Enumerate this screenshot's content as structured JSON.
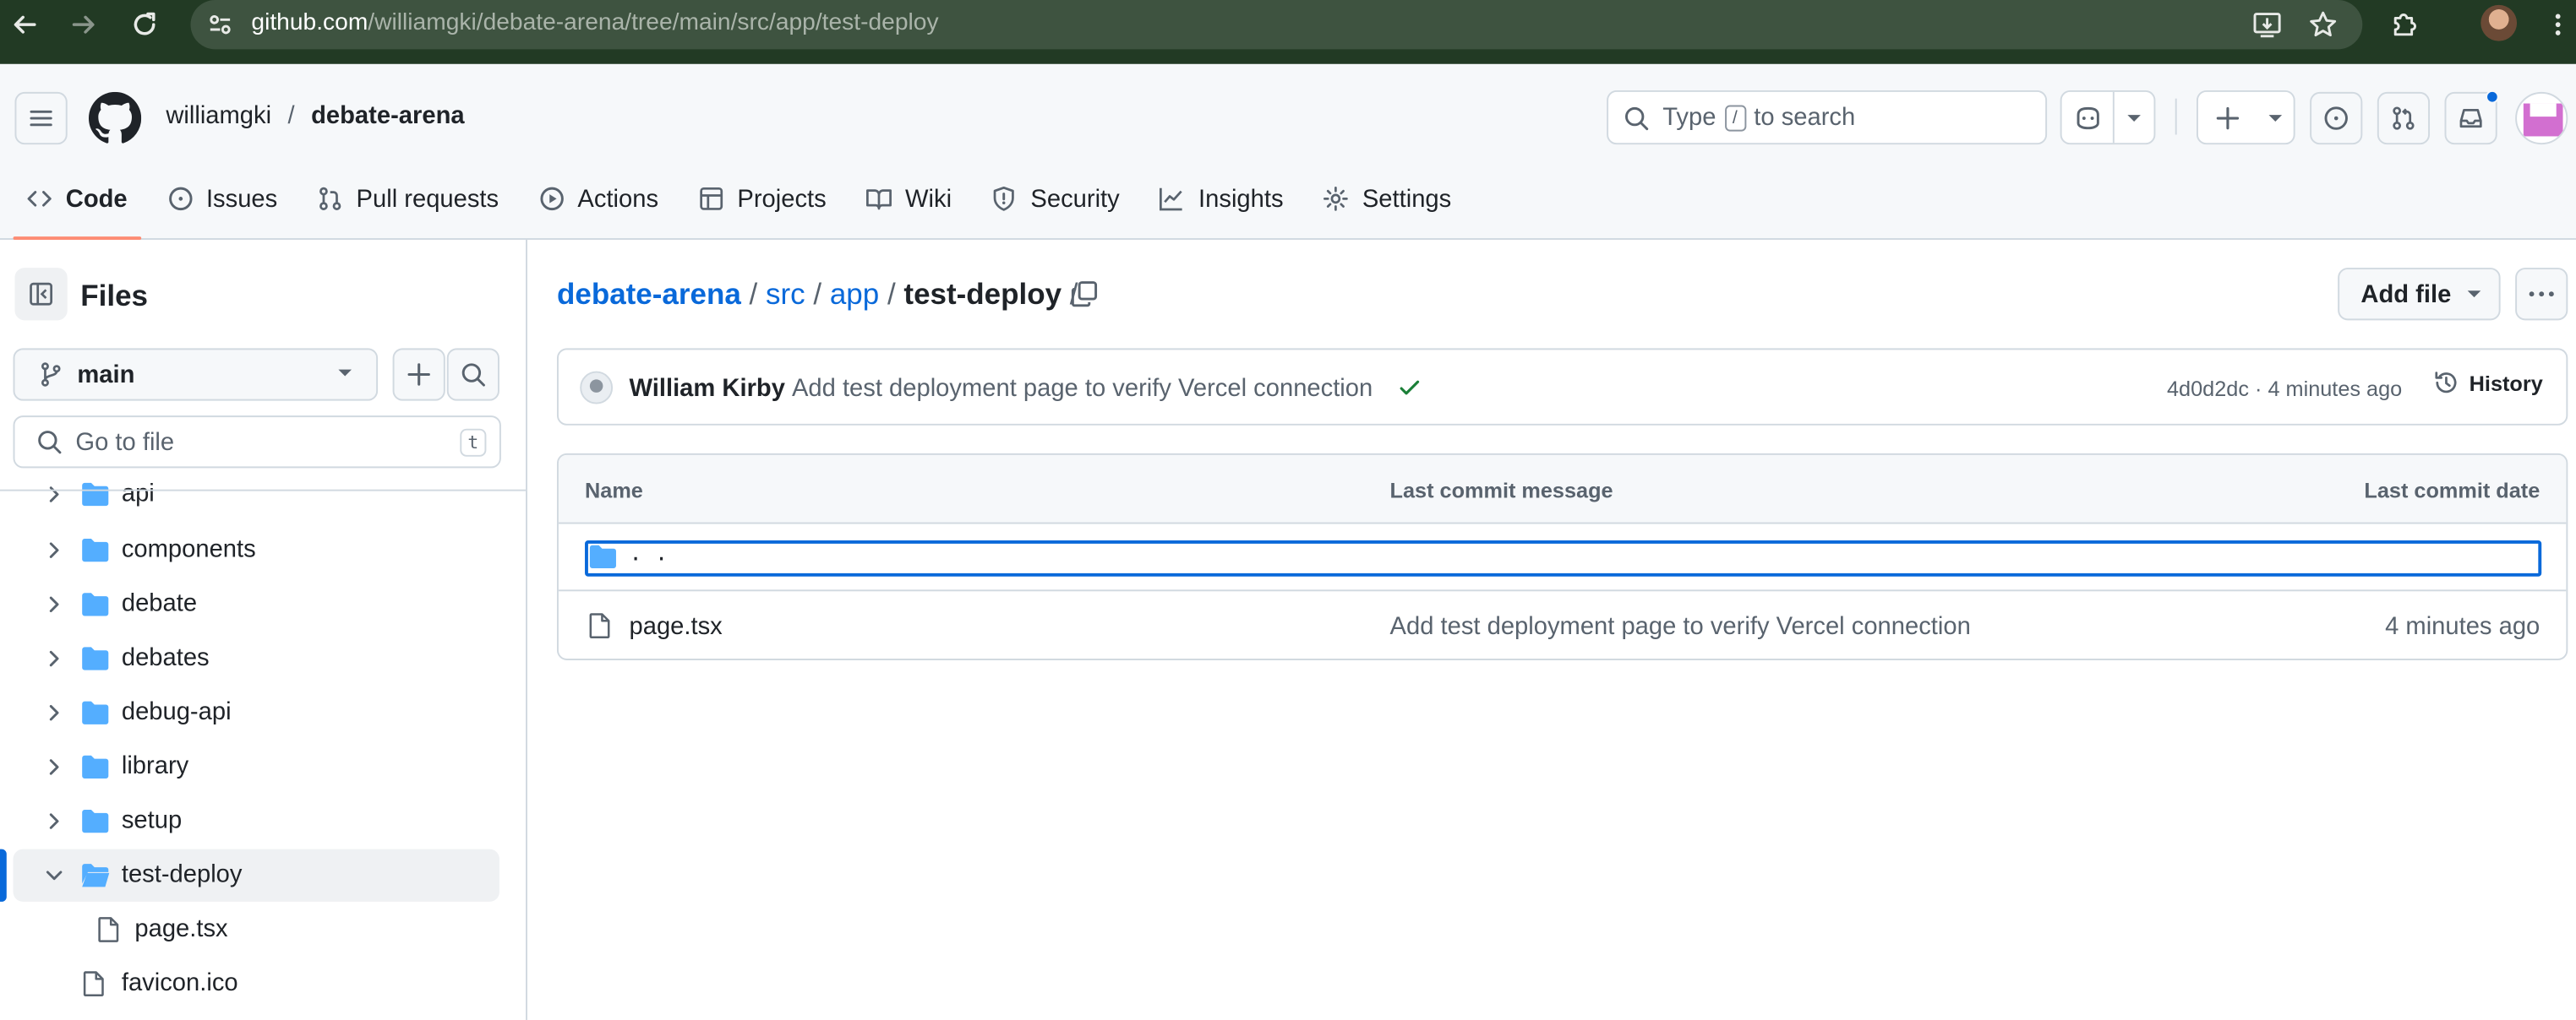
{
  "browser": {
    "url_host": "github.com",
    "url_path": "/williamgki/debate-arena/tree/main/src/app/test-deploy"
  },
  "header": {
    "owner": "williamgki",
    "separator": "/",
    "repo": "debate-arena",
    "search": {
      "prefix": "Type",
      "key": "/",
      "suffix": "to search"
    }
  },
  "tabs": [
    {
      "label": "Code",
      "icon": "code-icon",
      "selected": true
    },
    {
      "label": "Issues",
      "icon": "issue-opened-icon"
    },
    {
      "label": "Pull requests",
      "icon": "git-pull-request-icon"
    },
    {
      "label": "Actions",
      "icon": "play-icon"
    },
    {
      "label": "Projects",
      "icon": "table-icon"
    },
    {
      "label": "Wiki",
      "icon": "book-icon"
    },
    {
      "label": "Security",
      "icon": "shield-icon"
    },
    {
      "label": "Insights",
      "icon": "graph-icon"
    },
    {
      "label": "Settings",
      "icon": "gear-icon"
    }
  ],
  "sidebar": {
    "title": "Files",
    "branch": "main",
    "goto_placeholder": "Go to file",
    "goto_key": "t",
    "tree": [
      {
        "label": "api",
        "type": "folder",
        "expanded": false
      },
      {
        "label": "components",
        "type": "folder",
        "expanded": false
      },
      {
        "label": "debate",
        "type": "folder",
        "expanded": false
      },
      {
        "label": "debates",
        "type": "folder",
        "expanded": false
      },
      {
        "label": "debug-api",
        "type": "folder",
        "expanded": false
      },
      {
        "label": "library",
        "type": "folder",
        "expanded": false
      },
      {
        "label": "setup",
        "type": "folder",
        "expanded": false
      },
      {
        "label": "test-deploy",
        "type": "folder",
        "expanded": true,
        "selected": true
      },
      {
        "label": "page.tsx",
        "type": "file",
        "depth": 1
      },
      {
        "label": "favicon.ico",
        "type": "file",
        "depth": 0
      }
    ]
  },
  "main": {
    "breadcrumb": {
      "root": "debate-arena",
      "p1": "src",
      "p2": "app",
      "current": "test-deploy",
      "sep": "/"
    },
    "add_file_label": "Add file",
    "commit": {
      "author": "William Kirby",
      "message": "Add test deployment page to verify Vercel connection",
      "sha": "4d0d2dc",
      "time": "4 minutes ago",
      "history_label": "History"
    },
    "table": {
      "headers": {
        "name": "Name",
        "message": "Last commit message",
        "date": "Last commit date"
      },
      "parent_label": ". .",
      "rows": [
        {
          "name": "page.tsx",
          "message": "Add test deployment page to verify Vercel connection",
          "date": "4 minutes ago"
        }
      ]
    }
  },
  "colors": {
    "accent": "#0969da",
    "tab_underline": "#fd8c73",
    "folder": "#54aeff",
    "success": "#1a7f37",
    "chrome_bg": "#223a24"
  }
}
